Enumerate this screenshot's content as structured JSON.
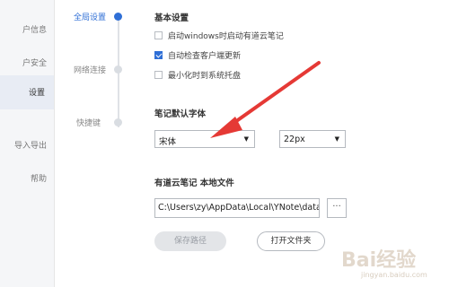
{
  "left_nav": {
    "items": [
      {
        "label": "户信息"
      },
      {
        "label": "户安全"
      },
      {
        "label": "设置"
      },
      {
        "label": "导入导出"
      },
      {
        "label": "帮助"
      }
    ]
  },
  "timeline": {
    "items": [
      {
        "label": "全局设置"
      },
      {
        "label": "网络连接"
      },
      {
        "label": "快捷键"
      }
    ]
  },
  "basic": {
    "title": "基本设置",
    "options": [
      {
        "label": "启动windows时启动有道云笔记",
        "checked": false
      },
      {
        "label": "自动检查客户端更新",
        "checked": true
      },
      {
        "label": "最小化时到系统托盘",
        "checked": false
      }
    ]
  },
  "font": {
    "title": "笔记默认字体",
    "family_value": "宋体",
    "size_value": "22px",
    "arrow_glyph": "▼"
  },
  "storage": {
    "title": "有道云笔记  本地文件",
    "path_value": "C:\\Users\\zy\\AppData\\Local\\YNote\\data\\",
    "browse_label": "···",
    "save_label": "保存路径",
    "open_label": "打开文件夹"
  },
  "colors": {
    "accent": "#2f6fd6",
    "annotation_arrow": "#e53935"
  }
}
